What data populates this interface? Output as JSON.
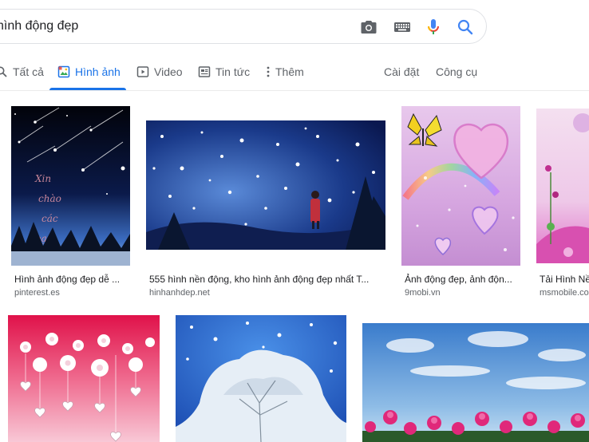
{
  "search": {
    "query": "hình động đẹp"
  },
  "tabs": [
    {
      "label": "Tất cả",
      "icon": "search-icon"
    },
    {
      "label": "Hình ảnh",
      "icon": "image-icon"
    },
    {
      "label": "Video",
      "icon": "video-icon"
    },
    {
      "label": "Tin tức",
      "icon": "news-icon"
    },
    {
      "label": "Thêm",
      "icon": "more-vert-icon"
    }
  ],
  "tools": {
    "settings": "Cài đặt",
    "tools": "Công cụ"
  },
  "results": [
    {
      "title": "Hình ảnh động đẹp dễ ...",
      "source": "pinterest.es"
    },
    {
      "title": "555 hình nền động, kho hình ảnh động đẹp nhất T...",
      "source": "hinhanhdep.net"
    },
    {
      "title": "Ảnh động đẹp, ảnh độn...",
      "source": "9mobi.vn"
    },
    {
      "title": "Tải Hình Nề...",
      "source": "msmobile.com..."
    }
  ],
  "colors": {
    "accent": "#1a73e8",
    "tab_text": "#5f6368"
  }
}
